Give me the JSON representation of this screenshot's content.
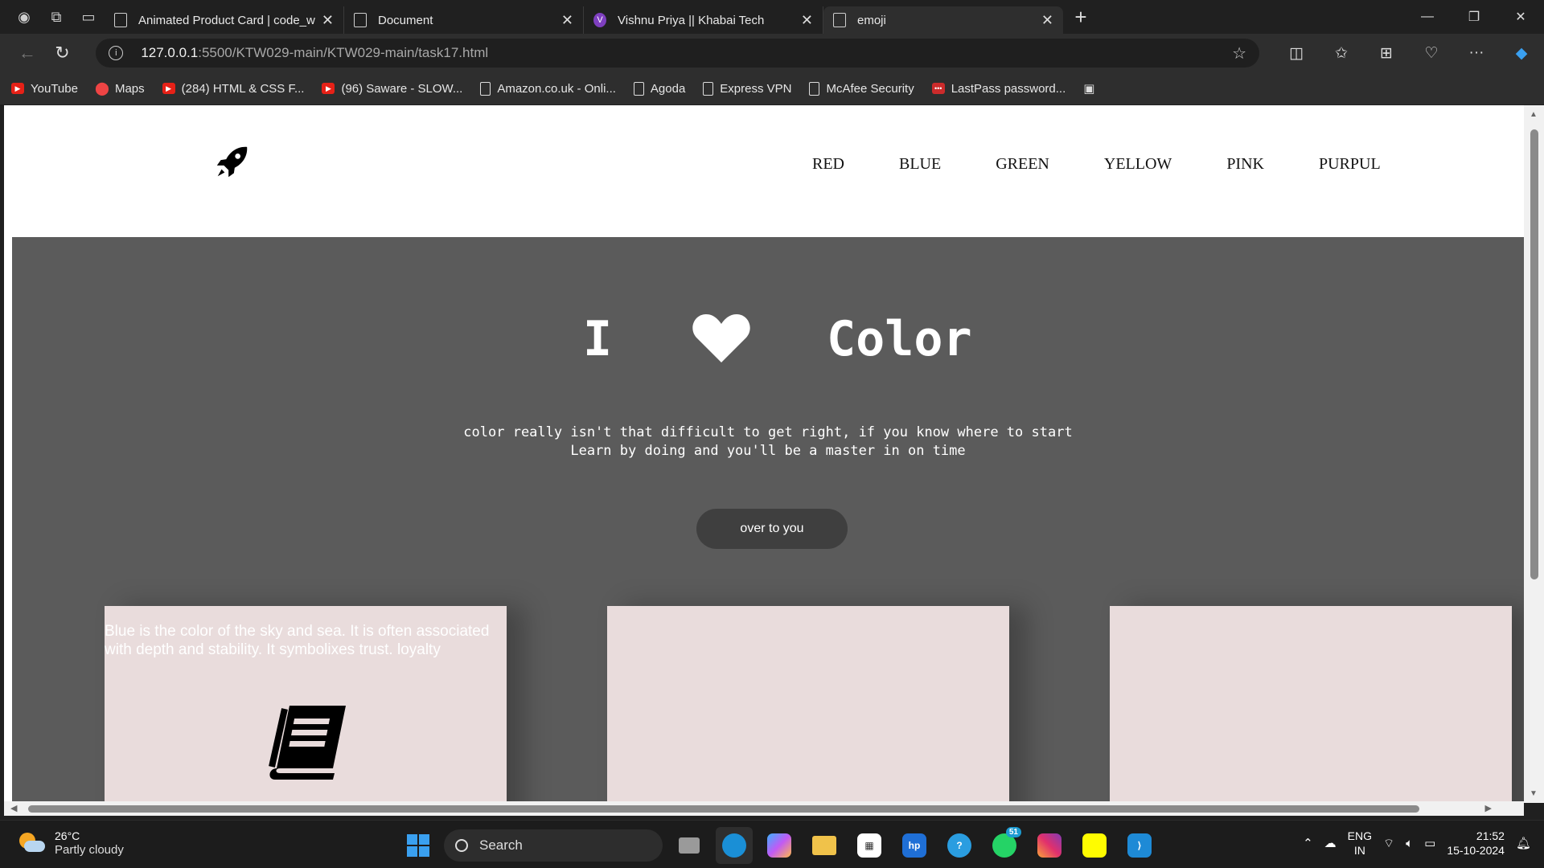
{
  "browser": {
    "tabs": [
      {
        "title": "Animated Product Card | code_wa",
        "icon": "page-icon",
        "active": false
      },
      {
        "title": "Document",
        "icon": "page-icon",
        "active": false
      },
      {
        "title": "Vishnu Priya || Khabai Tech",
        "icon": "v-avatar-icon",
        "active": false
      },
      {
        "title": "emoji",
        "icon": "page-icon",
        "active": true
      }
    ],
    "url_host": "127.0.0.1",
    "url_path": ":5500/KTW029-main/KTW029-main/task17.html",
    "bookmarks": [
      {
        "label": "YouTube",
        "icon": "youtube-icon"
      },
      {
        "label": "Maps",
        "icon": "maps-icon"
      },
      {
        "label": "(284) HTML & CSS F...",
        "icon": "youtube-icon"
      },
      {
        "label": "(96) Saware - SLOW...",
        "icon": "youtube-icon"
      },
      {
        "label": "Amazon.co.uk - Onli...",
        "icon": "page-icon"
      },
      {
        "label": "Agoda",
        "icon": "page-icon"
      },
      {
        "label": "Express VPN",
        "icon": "page-icon"
      },
      {
        "label": "McAfee Security",
        "icon": "page-icon"
      },
      {
        "label": "LastPass password...",
        "icon": "lastpass-icon"
      }
    ]
  },
  "page": {
    "nav": [
      "RED",
      "BLUE",
      "GREEN",
      "YELLOW",
      "PINK",
      "PURPUL"
    ],
    "hero": {
      "word_i": "I",
      "word_color": "Color",
      "line1": "color really isn't that difficult to get right, if you know where to start",
      "line2": "Learn by doing and you'll be a master in on time",
      "button": "over to you"
    },
    "cards": [
      {
        "text": "Blue is the color of the sky and sea. It is often associated with depth and stability. It symbolixes trust. loyalty"
      },
      {
        "text": ""
      },
      {
        "text": ""
      }
    ],
    "colors": {
      "hero_bg": "#5b5b5b",
      "card_bg": "#e9dcdc",
      "button_bg": "#3f3f3f"
    }
  },
  "taskbar": {
    "temperature": "26°C",
    "weather": "Partly cloudy",
    "search": "Search",
    "whatsapp_badge": "51",
    "lang_top": "ENG",
    "lang_bottom": "IN",
    "time": "21:52",
    "date": "15-10-2024"
  }
}
